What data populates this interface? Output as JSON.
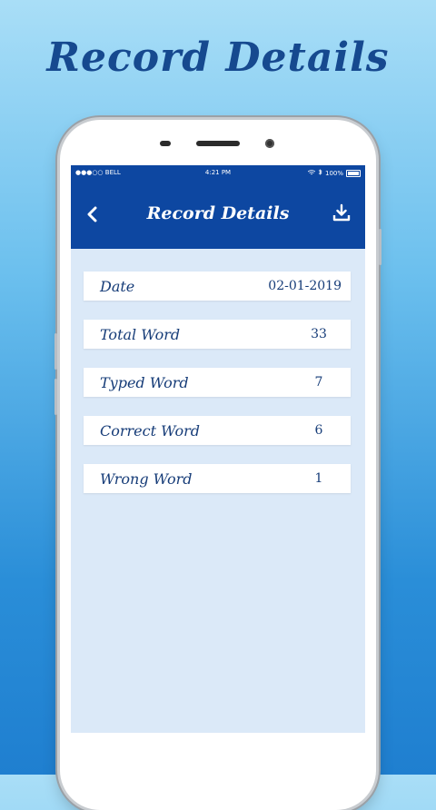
{
  "promo": {
    "title": "Record Details"
  },
  "status_bar": {
    "carrier": "●●●○○ BELL",
    "time": "4:21 PM",
    "battery": "100%"
  },
  "app_bar": {
    "title": "Record Details",
    "back_icon": "chevron-left-icon",
    "download_icon": "download-icon"
  },
  "records": [
    {
      "label": "Date",
      "value": "02-01-2019"
    },
    {
      "label": "Total Word",
      "value": "33"
    },
    {
      "label": "Typed Word",
      "value": "7"
    },
    {
      "label": "Correct Word",
      "value": "6"
    },
    {
      "label": "Wrong Word",
      "value": "1"
    }
  ],
  "colors": {
    "app_bar": "#0d47a1",
    "screen_bg": "#dbe9f8",
    "text": "#163c78"
  }
}
